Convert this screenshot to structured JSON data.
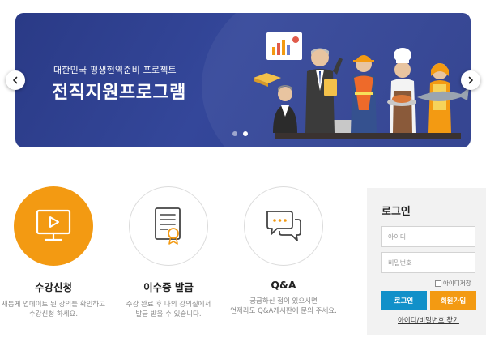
{
  "banner": {
    "subtitle": "대한민국 평생현역준비 프로젝트",
    "title": "전직지원프로그램",
    "slides": 2,
    "active_slide": 1
  },
  "nav": {
    "prev_icon": "chevron-left-icon",
    "next_icon": "chevron-right-icon"
  },
  "services": [
    {
      "label": "수강신청",
      "desc": "새롭게 업데이트 된 강의를 확인하고\n수강신청 하세요.",
      "icon": "monitor-play-icon"
    },
    {
      "label": "이수증 발급",
      "desc": "수강 완료 후 나의 강의실에서\n발급 받을 수 있습니다.",
      "icon": "certificate-icon"
    },
    {
      "label": "Q&A",
      "desc": "궁금하신 점이 있으시면\n언제라도 Q&A게시판에 문의 주세요.",
      "icon": "chat-bubbles-icon"
    }
  ],
  "login": {
    "heading": "로그인",
    "id_placeholder": "아이디",
    "pw_placeholder": "비밀번호",
    "save_id_label": "아이디저장",
    "login_button": "로그인",
    "join_button": "회원가입",
    "find_link": "아이디/비밀번호 찾기"
  },
  "colors": {
    "banner": "#2f4190",
    "accent_orange": "#f39a12",
    "accent_blue": "#1190c9"
  }
}
